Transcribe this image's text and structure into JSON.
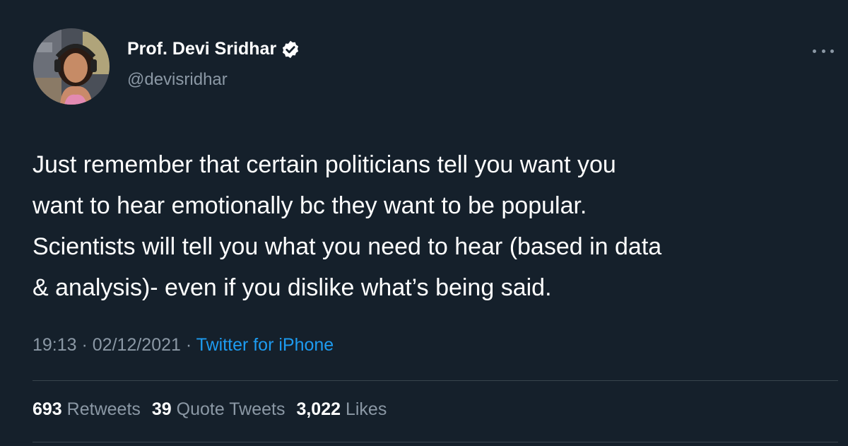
{
  "author": {
    "display_name": "Prof. Devi Sridhar",
    "handle": "@devisridhar",
    "verified": true,
    "verified_badge_icon": "verified-badge-icon",
    "avatar_icon": "profile-photo"
  },
  "tweet": {
    "text": "Just remember that certain politicians tell you want you\nwant to hear emotionally bc they want to be popular.\nScientists will tell you what you need to hear (based in data\n& analysis)- even if you dislike what’s being said.",
    "time": "19:13",
    "date": "02/12/2021",
    "separator": " · ",
    "source": "Twitter for iPhone"
  },
  "stats": {
    "retweets_count": "693",
    "retweets_label": "Retweets",
    "quotes_count": "39",
    "quotes_label": "Quote Tweets",
    "likes_count": "3,022",
    "likes_label": "Likes"
  },
  "more_menu_icon": "more-options-icon",
  "colors": {
    "background": "#15202b",
    "primary_text": "#ffffff",
    "secondary_text": "#8b98a5",
    "link": "#1d9bf0",
    "divider": "#38444d"
  }
}
